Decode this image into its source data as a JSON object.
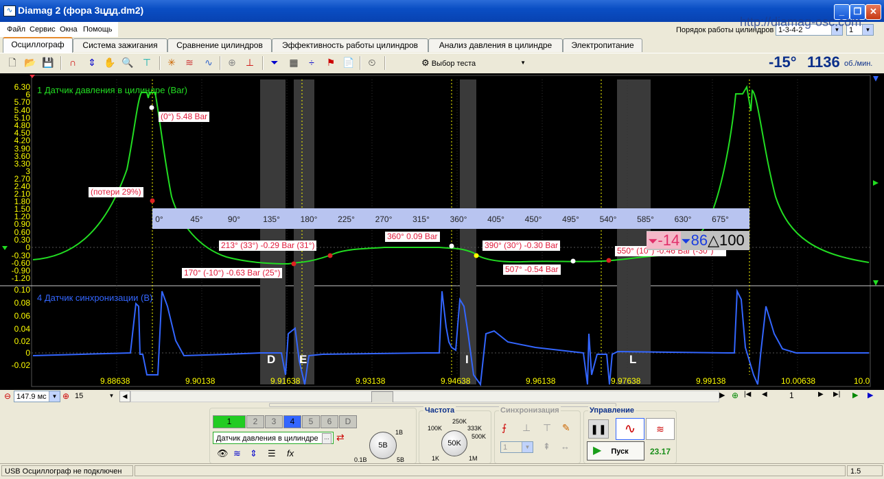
{
  "window": {
    "title": "Diamag 2 (фора 3цдд.dm2)"
  },
  "menu": [
    "Файл",
    "Сервис",
    "Окна",
    "Помощь"
  ],
  "firing_order": {
    "label": "Порядок работы цилиндров",
    "value": "1-3-4-2",
    "cyl": "1",
    "watermark": "http://diamag-osc.com"
  },
  "tabs": [
    "Осциллограф",
    "Система зажигания",
    "Сравнение цилиндров",
    "Эффективность работы цилиндров",
    "Анализ давления в цилиндре",
    "Электропитание"
  ],
  "toolbar": {
    "test_select": "Выбор теста",
    "angle": "-15°",
    "rpm": "1136",
    "rpm_unit": "об./мин."
  },
  "scope": {
    "ch1": {
      "name": "1 Датчик давления в цилиндре (Bar)",
      "color": "#22dd22",
      "yticks": [
        "6.30",
        "6",
        "5.70",
        "5.40",
        "5.10",
        "4.80",
        "4.50",
        "4.20",
        "3.90",
        "3.60",
        "3.30",
        "3",
        "2.70",
        "2.40",
        "2.10",
        "1.80",
        "1.50",
        "1.20",
        "0.90",
        "0.60",
        "0.30",
        "0",
        "-0.30",
        "-0.60",
        "-0.90",
        "-1.20"
      ]
    },
    "ch4": {
      "name": "4 Датчик синхронизации (В)",
      "color": "#3366ff",
      "yticks": [
        "0.10",
        "0.08",
        "0.06",
        "0.04",
        "0.02",
        "0",
        "-0.02"
      ]
    },
    "degree_scale": [
      "0°",
      "45°",
      "90°",
      "135°",
      "180°",
      "225°",
      "270°",
      "315°",
      "360°",
      "405°",
      "450°",
      "495°",
      "540°",
      "585°",
      "630°",
      "675°"
    ],
    "annotations": [
      "(0°) 5.48 Bar",
      "(потери 29%)",
      "213° (33°) -0.29 Bar (31°)",
      "170° (-10°) -0.63 Bar (25°)",
      "360° 0.09 Bar",
      "390° (30°) -0.30 Bar",
      "507° -0.54 Bar",
      "550° (10°) -0.46 Bar (-30°)"
    ],
    "cursor_box": {
      "a": "-14",
      "b": "86",
      "delta": "100"
    },
    "zone_labels": [
      "D",
      "E",
      "I",
      "L"
    ],
    "xticks": [
      "9.88638",
      "9.90138",
      "9.91638",
      "9.93138",
      "9.94638",
      "9.96138",
      "9.97638",
      "9.99138",
      "10.00638",
      "10.0"
    ]
  },
  "scrollbar": {
    "timebase": "147.9 мс",
    "zoom": "15",
    "page": "1"
  },
  "channels": {
    "buttons": [
      "1",
      "2",
      "3",
      "4",
      "5",
      "6",
      "D"
    ],
    "sensor": "Датчик давления в цилиндре",
    "range_label": "5В",
    "range_min": "0.1В",
    "range_top": "1В",
    "range_max": "5В"
  },
  "frequency": {
    "title": "Частота",
    "value": "50K",
    "marks": [
      "100K",
      "250K",
      "333K",
      "500K",
      "1K",
      "1M"
    ]
  },
  "sync": {
    "title": "Синхронизация",
    "value": "1"
  },
  "control": {
    "title": "Управление",
    "start": "Пуск",
    "value": "23.17"
  },
  "status": {
    "left": "USB Осциллограф не подключен",
    "right": "1.5"
  }
}
